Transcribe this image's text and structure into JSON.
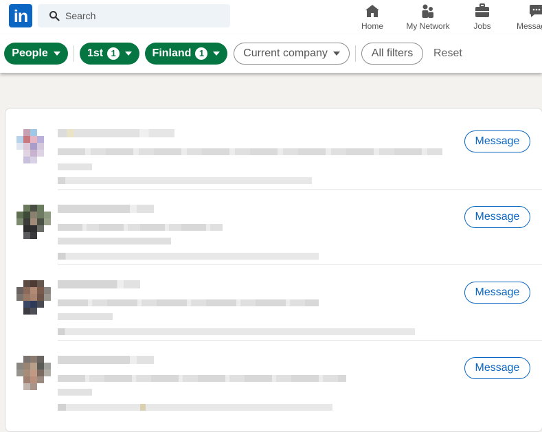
{
  "brand": {
    "logo_text": "in",
    "color": "#0a66c2"
  },
  "search": {
    "placeholder": "Search",
    "icon": "search-icon"
  },
  "nav": {
    "items": [
      {
        "label": "Home",
        "icon": "home-icon"
      },
      {
        "label": "My Network",
        "icon": "my-network-icon"
      },
      {
        "label": "Jobs",
        "icon": "jobs-icon"
      },
      {
        "label": "Messag",
        "icon": "messaging-icon"
      }
    ]
  },
  "filters": {
    "people": {
      "label": "People"
    },
    "connection": {
      "label": "1st",
      "count": "1"
    },
    "location": {
      "label": "Finland",
      "count": "1"
    },
    "current_company": {
      "label": "Current company"
    },
    "all_filters": {
      "label": "All filters"
    },
    "reset": {
      "label": "Reset"
    },
    "active_color": "#057642"
  },
  "results": {
    "message_label": "Message",
    "rows": [
      {
        "message_label": "Message"
      },
      {
        "message_label": "Message"
      },
      {
        "message_label": "Message"
      },
      {
        "message_label": "Message"
      }
    ]
  }
}
